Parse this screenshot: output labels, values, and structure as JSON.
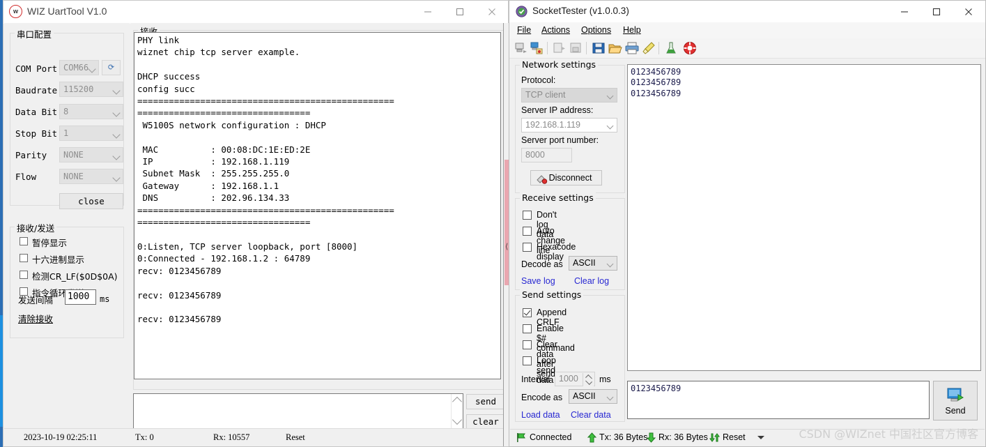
{
  "uart": {
    "title": "WIZ UartTool V1.0",
    "logo": "wiz-logo-icon",
    "window_buttons": {
      "minimize": "minimize-icon",
      "maximize": "maximize-icon",
      "close": "close-icon"
    },
    "serial_group": {
      "title": "串口配置",
      "fields": [
        {
          "label": "COM Port",
          "value": "COM66"
        },
        {
          "label": "Baudrate",
          "value": "115200"
        },
        {
          "label": "Data Bit",
          "value": "8"
        },
        {
          "label": "Stop Bit",
          "value": "1"
        },
        {
          "label": "Parity",
          "value": "NONE"
        },
        {
          "label": "Flow",
          "value": "NONE"
        }
      ],
      "refresh_icon": "refresh-ports-icon",
      "close_button": "close"
    },
    "rxtx_group": {
      "title": "接收/发送",
      "checkboxes": [
        {
          "label": "暂停显示",
          "checked": false
        },
        {
          "label": "十六进制显示",
          "checked": false
        },
        {
          "label": "检测CR_LF($0D$0A)",
          "checked": false
        },
        {
          "label": "指令循环发送",
          "checked": false
        }
      ],
      "interval_label": "发送间隔",
      "interval_value": "1000",
      "interval_unit": "ms",
      "clear_link": "清除接收"
    },
    "receive_group": {
      "title": "接收"
    },
    "terminal_text": "PHY link\nwiznet chip tcp server example.\n\nDHCP success\nconfig succ\n=================================================\n=================================\n W5100S network configuration : DHCP\n\n MAC          : 00:08:DC:1E:ED:2E\n IP           : 192.168.1.119\n Subnet Mask  : 255.255.255.0\n Gateway      : 192.168.1.1\n DNS          : 202.96.134.33\n=================================================\n=================================\n\n0:Listen, TCP server loopback, port [8000]\n0:Connected - 192.168.1.2 : 64789\nrecv: 0123456789\n\nrecv: 0123456789\n\nrecv: 0123456789",
    "send_input_value": "",
    "buttons": {
      "send": "send",
      "clear": "clear"
    },
    "statusbar": {
      "time": "2023-10-19 02:25:11",
      "tx": "Tx: 0",
      "rx": "Rx: 10557",
      "reset": "Reset"
    }
  },
  "socket_tester": {
    "title": "SocketTester (v1.0.0.3)",
    "logo": "shield-check-icon",
    "window_buttons": {
      "minimize": "minimize-icon",
      "maximize": "maximize-icon",
      "close": "close-icon"
    },
    "menu": [
      {
        "label": "File",
        "mnemonic": "F"
      },
      {
        "label": "Actions",
        "mnemonic": "A"
      },
      {
        "label": "Options",
        "mnemonic": "O"
      },
      {
        "label": "Help",
        "mnemonic": "H"
      }
    ],
    "toolbar_icons": [
      "connect-icon",
      "disconnect-icon",
      "start-log-icon",
      "stop-log-icon",
      "save-icon",
      "open-icon",
      "print-icon",
      "clear-icon",
      "test-icon",
      "help-ring-icon"
    ],
    "network_settings": {
      "title": "Network settings",
      "protocol_label": "Protocol:",
      "protocol_value": "TCP client",
      "server_ip_label": "Server IP address:",
      "server_ip_value": "192.168.1.119",
      "server_port_label": "Server port number:",
      "server_port_value": "8000",
      "disconnect_button": "Disconnect",
      "disconnect_icon": "disconnect-plug-icon"
    },
    "receive_settings": {
      "title": "Receive settings",
      "checkboxes": [
        {
          "label": "Don't log data",
          "checked": false
        },
        {
          "label": "Auto change line",
          "checked": false
        },
        {
          "label": "Hexacode display",
          "checked": false
        }
      ],
      "decode_label": "Decode as",
      "decode_value": "ASCII",
      "save_log_link": "Save log",
      "clear_log_link": "Clear log"
    },
    "send_settings": {
      "title": "Send settings",
      "checkboxes": [
        {
          "label": "Append CRLF",
          "checked": true
        },
        {
          "label": "Enable $# command",
          "checked": false
        },
        {
          "label": "Clear data after send",
          "checked": false
        },
        {
          "label": "Loop send data",
          "checked": false
        }
      ],
      "interval_label": "Interval",
      "interval_value": "1000",
      "interval_unit": "ms",
      "encode_label": "Encode as",
      "encode_value": "ASCII",
      "load_data_link": "Load data",
      "clear_data_link": "Clear data"
    },
    "log_text": "0123456789\n0123456789\n0123456789",
    "send_text": "0123456789",
    "send_button": {
      "label": "Send",
      "icon": "send-icon"
    },
    "statusbar": {
      "connected": "Connected",
      "connected_icon": "flag-icon",
      "tx": "Tx: 36 Bytes",
      "tx_icon": "up-arrow-icon",
      "rx": "Rx: 36 Bytes",
      "rx_icon": "down-arrow-icon",
      "reset": "Reset",
      "reset_icon": "reset-icon"
    }
  },
  "watermark": "CSDN @WIZnet 中国社区官方博客",
  "colors": {
    "accent_blue": "#2727d2",
    "desktop": "#2d6fb5",
    "scrollbar_thumb": "#eaa7b0"
  }
}
